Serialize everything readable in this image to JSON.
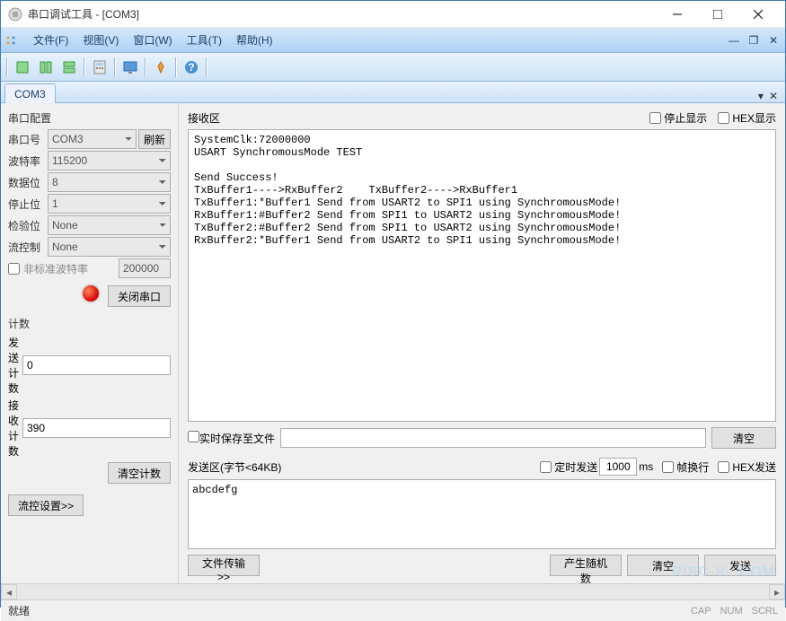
{
  "window": {
    "title": "串口调试工具 - [COM3]"
  },
  "menu": {
    "file": "文件(F)",
    "view": "视图(V)",
    "window": "窗口(W)",
    "tools": "工具(T)",
    "help": "帮助(H)"
  },
  "tab": {
    "label": "COM3"
  },
  "sidebar": {
    "config_title": "串口配置",
    "port_label": "串口号",
    "port_value": "COM3",
    "refresh": "刷新",
    "baud_label": "波特率",
    "baud_value": "115200",
    "databits_label": "数据位",
    "databits_value": "8",
    "stopbits_label": "停止位",
    "stopbits_value": "1",
    "parity_label": "检验位",
    "parity_value": "None",
    "flow_label": "流控制",
    "flow_value": "None",
    "nonstd_label": "非标准波特率",
    "nonstd_value": "200000",
    "close_port": "关闭串口",
    "count_title": "计数",
    "send_count_label": "发送计数",
    "send_count_value": "0",
    "recv_count_label": "接收计数",
    "recv_count_value": "390",
    "clear_count": "清空计数",
    "flow_settings": "流控设置>>"
  },
  "recv": {
    "title": "接收区",
    "stop_display": "停止显示",
    "hex_display": "HEX显示",
    "content": "SystemClk:72000000\nUSART SynchromousMode TEST\n\nSend Success!\nTxBuffer1---->RxBuffer2    TxBuffer2---->RxBuffer1\nTxBuffer1:*Buffer1 Send from USART2 to SPI1 using SynchromousMode!\nRxBuffer1:#Buffer2 Send from SPI1 to USART2 using SynchromousMode!\nTxBuffer2:#Buffer2 Send from SPI1 to USART2 using SynchromousMode!\nRxBuffer2:*Buffer1 Send from USART2 to SPI1 using SynchromousMode!",
    "save_to_file": "实时保存至文件",
    "clear": "清空"
  },
  "send": {
    "title": "发送区(字节<64KB)",
    "timed_send": "定时发送",
    "interval": "1000",
    "ms": "ms",
    "frame_wrap": "帧换行",
    "hex_send": "HEX发送",
    "content": "abcdefg",
    "file_transfer": "文件传输>>",
    "gen_random": "产生随机数",
    "clear": "清空",
    "send_btn": "发送"
  },
  "status": {
    "ready": "就绪",
    "cap": "CAP",
    "num": "NUM",
    "scrl": "SCRL"
  },
  "watermark": "RISC-V...COM"
}
